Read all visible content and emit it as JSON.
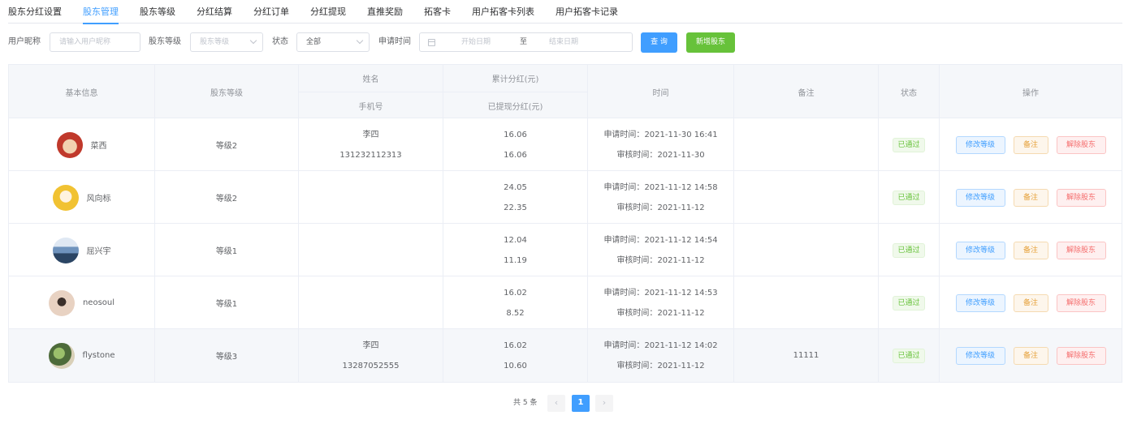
{
  "tabs": [
    "股东分红设置",
    "股东管理",
    "股东等级",
    "分红结算",
    "分红订单",
    "分红提现",
    "直推奖励",
    "拓客卡",
    "用户拓客卡列表",
    "用户拓客卡记录"
  ],
  "active_tab": 1,
  "filters": {
    "nickname_label": "用户昵称",
    "nickname_placeholder": "请输入用户昵称",
    "level_label": "股东等级",
    "level_placeholder": "股东等级",
    "status_label": "状态",
    "status_value": "全部",
    "date_label": "申请时间",
    "date_start_placeholder": "开始日期",
    "date_sep": "至",
    "date_end_placeholder": "结束日期",
    "query_button": "查 询",
    "add_button": "新增股东"
  },
  "table": {
    "headers": {
      "basic_info": "基本信息",
      "level": "股东等级",
      "name": "姓名",
      "phone": "手机号",
      "total_dividend": "累计分红(元)",
      "withdrawn_dividend": "已提现分红(元)",
      "time": "时间",
      "remark": "备注",
      "status": "状态",
      "actions": "操作"
    },
    "apply_prefix": "申请时间：",
    "audit_prefix": "审核时间：",
    "action_labels": {
      "edit_level": "修改等级",
      "remark": "备注",
      "remove": "解除股东"
    },
    "rows": [
      {
        "nickname": "菜西",
        "level": "等级2",
        "name": "李四",
        "phone": "131232112313",
        "total": "16.06",
        "withdrawn": "16.06",
        "apply_time": "2021-11-30 16:41",
        "audit_time": "2021-11-30",
        "remark": "",
        "status": "已通过"
      },
      {
        "nickname": "风向标",
        "level": "等级2",
        "name": "",
        "phone": "",
        "total": "24.05",
        "withdrawn": "22.35",
        "apply_time": "2021-11-12 14:58",
        "audit_time": "2021-11-12",
        "remark": "",
        "status": "已通过"
      },
      {
        "nickname": "屈兴宇",
        "level": "等级1",
        "name": "",
        "phone": "",
        "total": "12.04",
        "withdrawn": "11.19",
        "apply_time": "2021-11-12 14:54",
        "audit_time": "2021-11-12",
        "remark": "",
        "status": "已通过"
      },
      {
        "nickname": "neosoul",
        "level": "等级1",
        "name": "",
        "phone": "",
        "total": "16.02",
        "withdrawn": "8.52",
        "apply_time": "2021-11-12 14:53",
        "audit_time": "2021-11-12",
        "remark": "",
        "status": "已通过"
      },
      {
        "nickname": "flystone",
        "level": "等级3",
        "name": "李四",
        "phone": "13287052555",
        "total": "16.02",
        "withdrawn": "10.60",
        "apply_time": "2021-11-12 14:02",
        "audit_time": "2021-11-12",
        "remark": "11111",
        "status": "已通过"
      }
    ]
  },
  "pagination": {
    "total_text": "共 5 条",
    "current_page": "1",
    "prev_icon": "‹",
    "next_icon": "›"
  }
}
